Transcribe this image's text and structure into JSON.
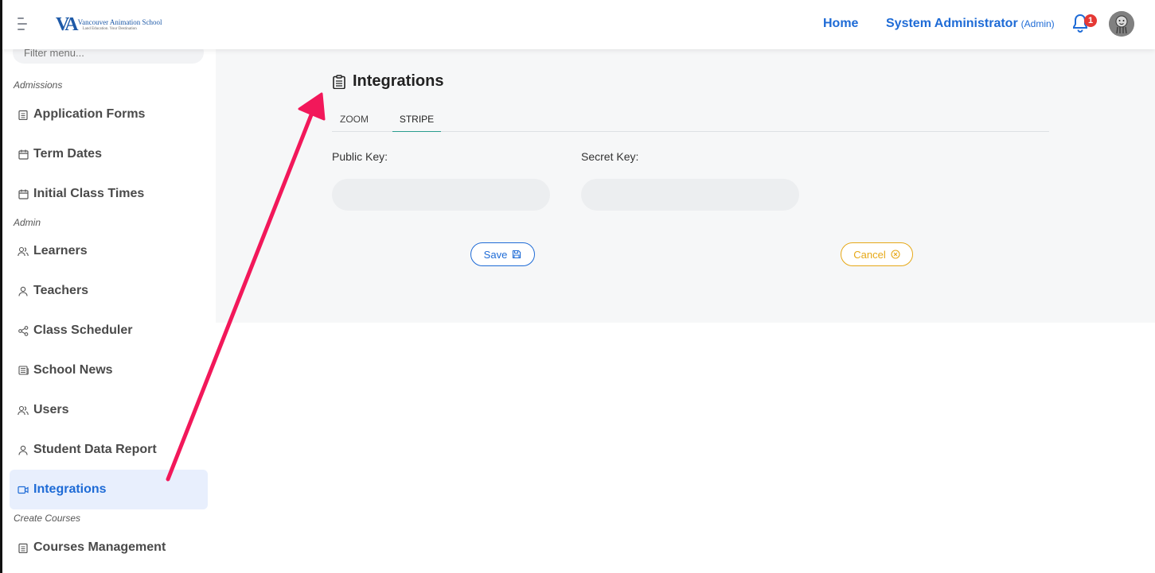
{
  "header": {
    "logo_name": "Vancouver Animation School",
    "logo_tagline": "Land Education. Your Destination",
    "home_label": "Home",
    "user_name": "System Administrator",
    "user_role": "(Admin)",
    "notification_count": "1"
  },
  "sidebar": {
    "filter_placeholder": "Filter menu...",
    "sections": [
      {
        "label": "Admissions"
      },
      {
        "label": "Admin"
      },
      {
        "label": "Create Courses"
      }
    ],
    "items": [
      {
        "label": "Application Forms",
        "icon": "clipboard-icon"
      },
      {
        "label": "Term Dates",
        "icon": "calendar-icon"
      },
      {
        "label": "Initial Class Times",
        "icon": "calendar-icon"
      },
      {
        "label": "Learners",
        "icon": "users-icon"
      },
      {
        "label": "Teachers",
        "icon": "user-icon"
      },
      {
        "label": "Class Scheduler",
        "icon": "share-icon"
      },
      {
        "label": "School News",
        "icon": "newspaper-icon"
      },
      {
        "label": "Users",
        "icon": "users-icon"
      },
      {
        "label": "Student Data Report",
        "icon": "user-icon"
      },
      {
        "label": "Integrations",
        "icon": "video-icon",
        "active": true
      },
      {
        "label": "Courses Management",
        "icon": "clipboard-icon"
      }
    ]
  },
  "main": {
    "title": "Integrations",
    "tabs": [
      {
        "label": "ZOOM"
      },
      {
        "label": "STRIPE",
        "active": true
      }
    ],
    "public_key_label": "Public Key:",
    "public_key_value": "",
    "secret_key_label": "Secret Key:",
    "secret_key_value": "",
    "save_label": "Save",
    "cancel_label": "Cancel"
  },
  "colors": {
    "accent": "#1e6bd6",
    "cancel": "#e6a817",
    "tab_underline": "#2a9d8f",
    "annotation_arrow": "#f2185a",
    "badge": "#e53935"
  }
}
